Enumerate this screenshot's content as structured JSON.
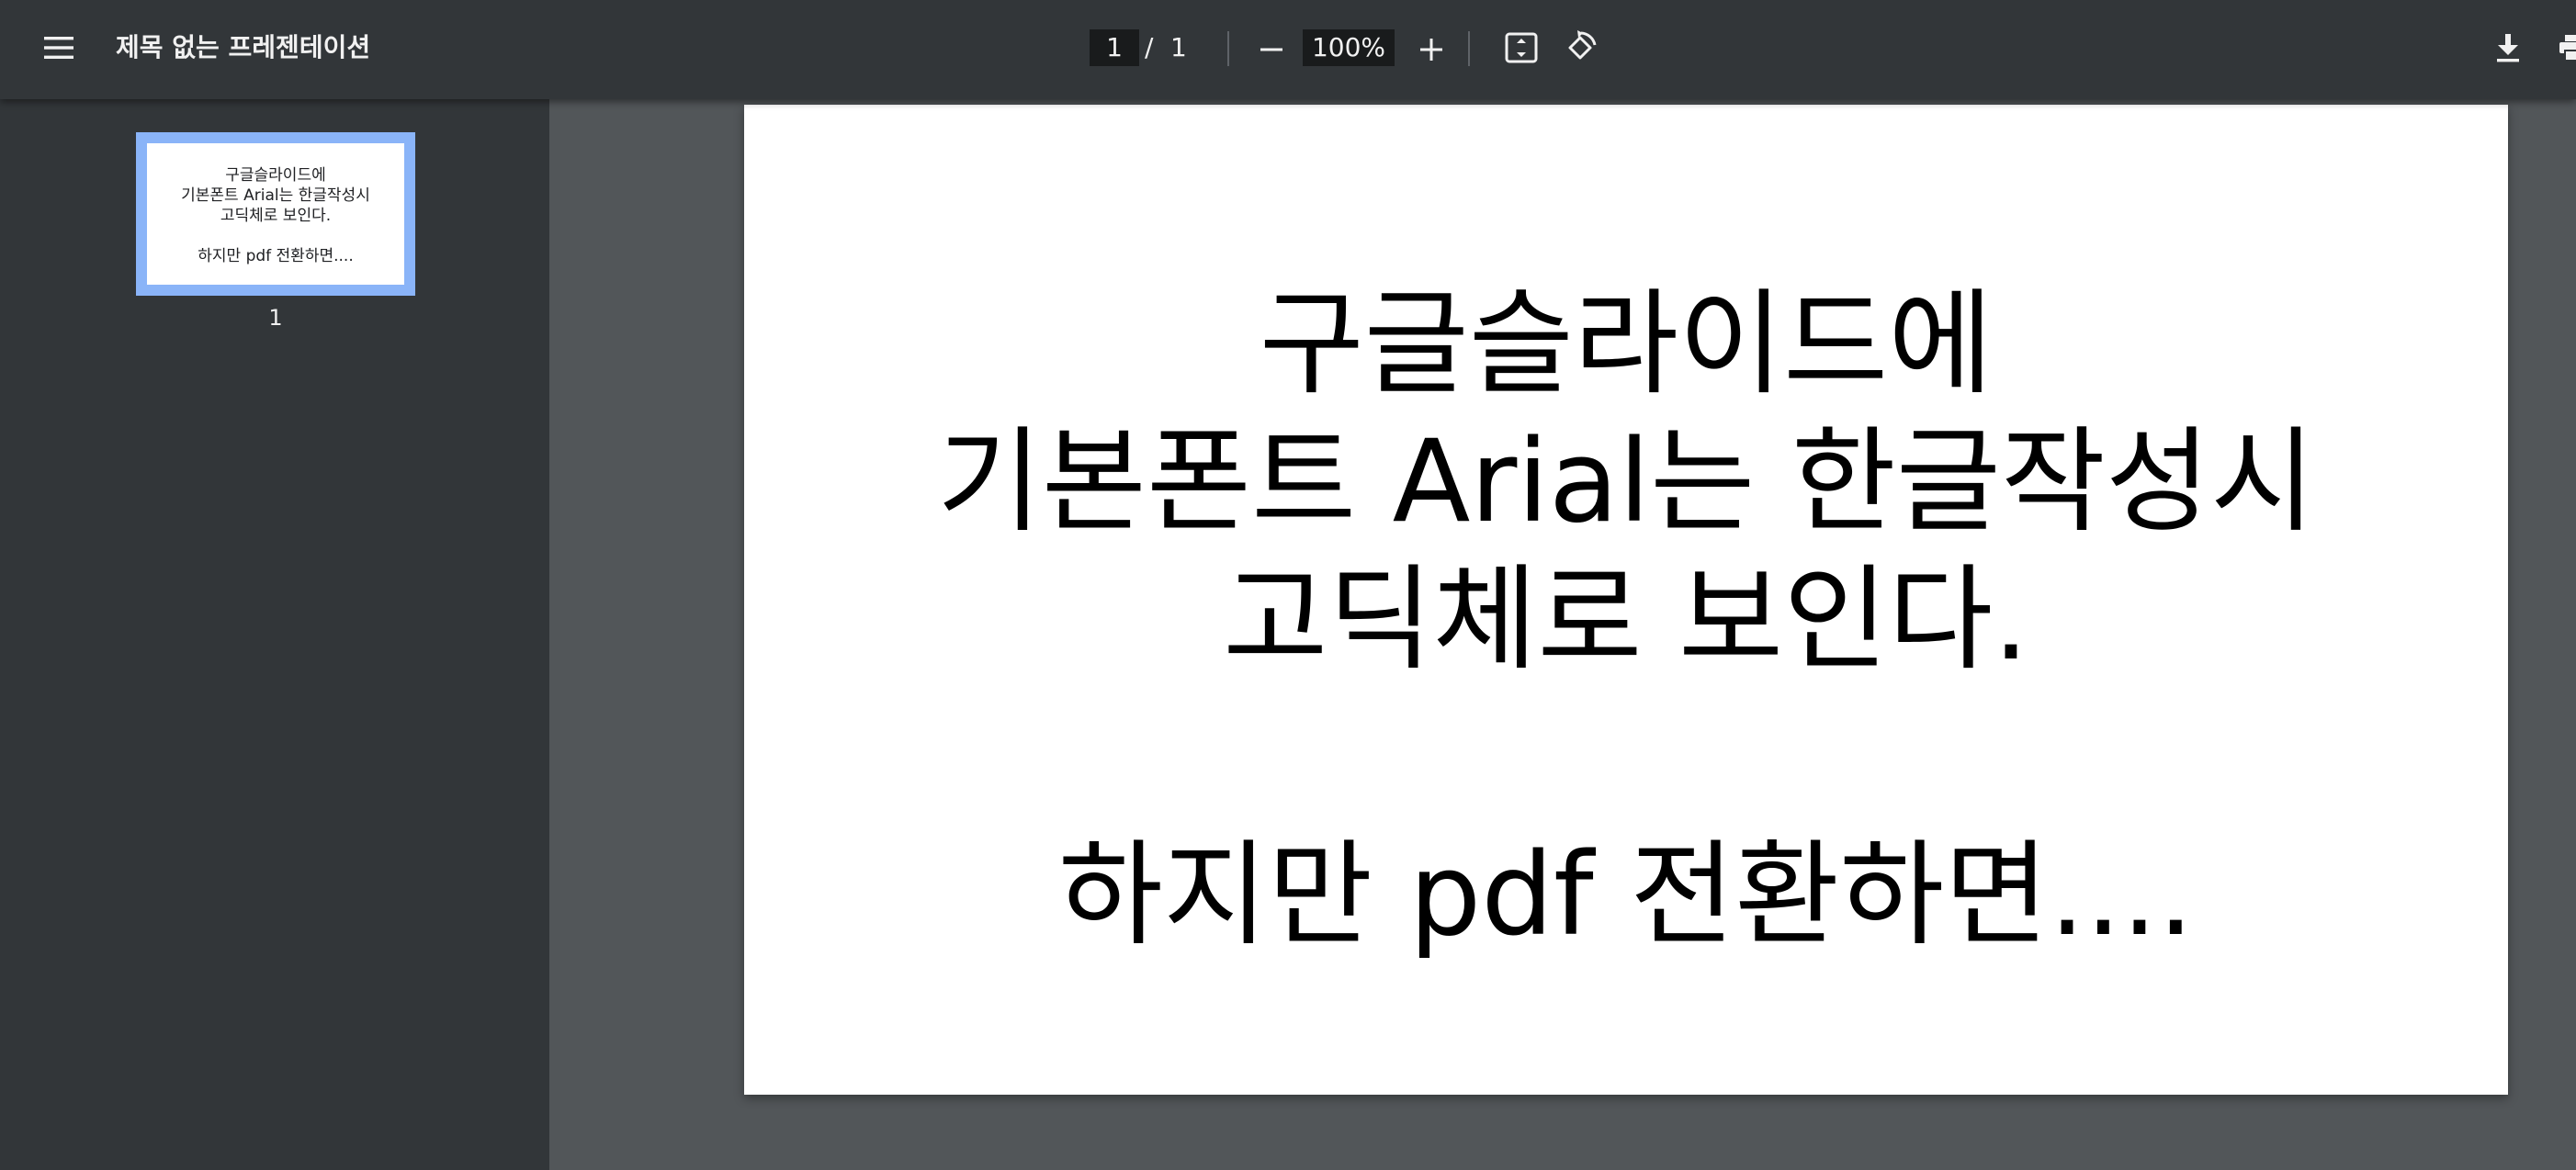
{
  "toolbar": {
    "title": "제목 없는 프레젠테이션",
    "page_current": "1",
    "page_separator": "/",
    "page_total": "1",
    "zoom": "100%",
    "icons": {
      "menu": "menu-icon",
      "zoom_out": "minus-icon",
      "zoom_in": "plus-icon",
      "fit": "fit-to-page-icon",
      "rotate": "rotate-icon",
      "download": "download-icon",
      "print": "print-icon"
    }
  },
  "sidebar": {
    "thumbnails": [
      {
        "page_label": "1",
        "lines": [
          "구글슬라이드에",
          "기본폰트 Arial는 한글작성시",
          "고딕체로 보인다.",
          "",
          "하지만 pdf 전환하면...."
        ]
      }
    ]
  },
  "document": {
    "lines": [
      "구글슬라이드에",
      "기본폰트 Arial는 한글작성시",
      "고딕체로 보인다.",
      "",
      "하지만 pdf 전환하면...."
    ]
  },
  "colors": {
    "toolbar_bg": "#323639",
    "viewer_bg": "#525659",
    "thumbnail_selected": "#8ab4f8",
    "input_bg": "#191b1c"
  }
}
